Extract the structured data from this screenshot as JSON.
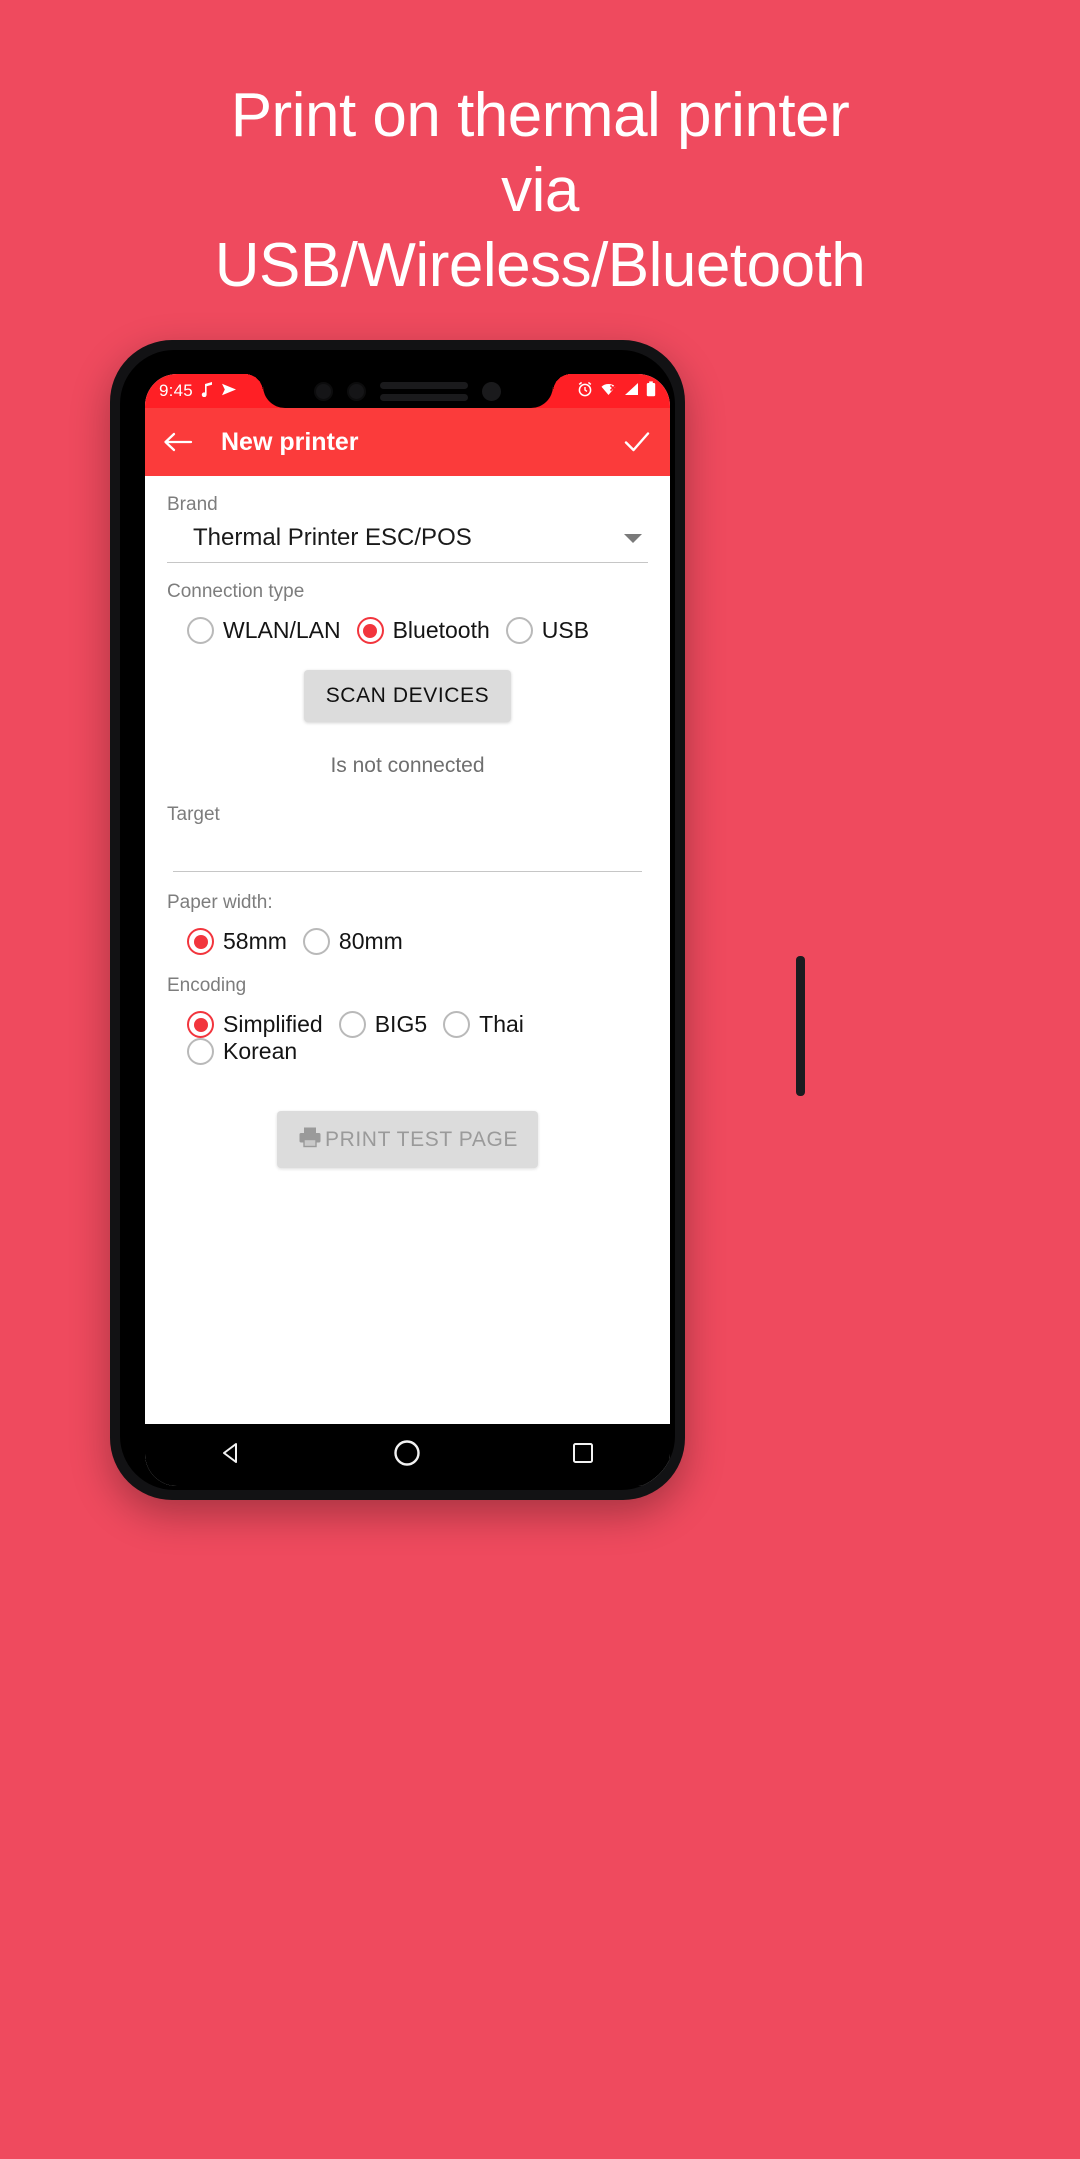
{
  "promo": {
    "lines": [
      "Print on thermal printer",
      "via",
      "USB/Wireless/Bluetooth"
    ],
    "bg_color": "#ef4a5e",
    "text_color": "#ffffff"
  },
  "statusbar": {
    "time": "9:45",
    "left_icons": [
      "music-note-icon",
      "send-icon"
    ],
    "right_icons": [
      "alarm-icon",
      "wifi-off-icon",
      "signal-icon",
      "battery-icon"
    ],
    "bg_color": "#ff1f25"
  },
  "appbar": {
    "back_icon": "arrow-back-icon",
    "title": "New printer",
    "confirm_icon": "check-icon",
    "bg_color": "#fb3b3b"
  },
  "form": {
    "brand": {
      "label": "Brand",
      "value": "Thermal Printer ESC/POS"
    },
    "connection_type": {
      "label": "Connection type",
      "options": [
        {
          "label": "WLAN/LAN",
          "selected": false
        },
        {
          "label": "Bluetooth",
          "selected": true
        },
        {
          "label": "USB",
          "selected": false
        }
      ]
    },
    "scan_button": "SCAN DEVICES",
    "connection_status": "Is not connected",
    "target": {
      "label": "Target",
      "value": ""
    },
    "paper_width": {
      "label": "Paper width:",
      "options": [
        {
          "label": "58mm",
          "selected": true
        },
        {
          "label": "80mm",
          "selected": false
        }
      ]
    },
    "encoding": {
      "label": "Encoding",
      "options": [
        {
          "label": "Simplified",
          "selected": true
        },
        {
          "label": "BIG5",
          "selected": false
        },
        {
          "label": "Thai",
          "selected": false
        },
        {
          "label": "Korean",
          "selected": false
        }
      ]
    },
    "print_test_button": {
      "label": "PRINT TEST PAGE",
      "icon": "printer-icon",
      "disabled": true
    },
    "accent_color": "#f2353d"
  },
  "navbar": {
    "items": [
      "back-triangle-icon",
      "home-circle-icon",
      "recents-square-icon"
    ]
  }
}
